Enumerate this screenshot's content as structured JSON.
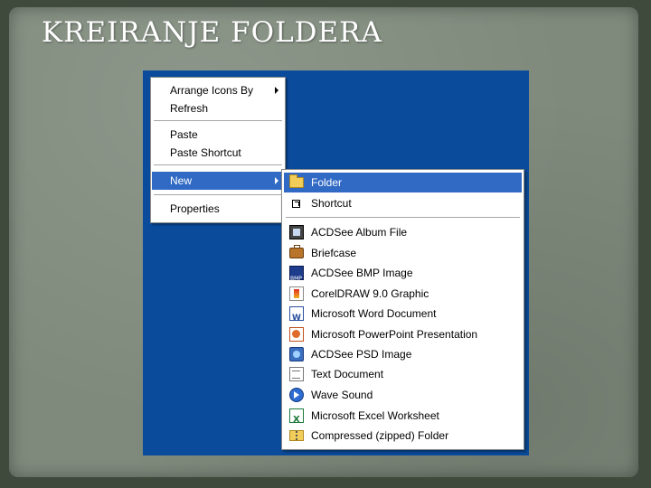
{
  "slide": {
    "title": "KREIRANJE FOLDERA"
  },
  "context_menu": {
    "items": [
      {
        "label": "Arrange Icons By",
        "submenu": true
      },
      {
        "label": "Refresh"
      },
      {
        "label": "Paste"
      },
      {
        "label": "Paste Shortcut"
      },
      {
        "label": "New",
        "submenu": true,
        "selected": true
      },
      {
        "label": "Properties"
      }
    ]
  },
  "new_submenu": {
    "items": [
      {
        "label": "Folder",
        "icon": "folder-icon",
        "selected": true
      },
      {
        "label": "Shortcut",
        "icon": "shortcut-icon"
      },
      {
        "label": "ACDSee Album File",
        "icon": "album-file-icon"
      },
      {
        "label": "Briefcase",
        "icon": "briefcase-icon"
      },
      {
        "label": "ACDSee BMP Image",
        "icon": "bmp-image-icon"
      },
      {
        "label": "CorelDRAW 9.0 Graphic",
        "icon": "coreldraw-icon"
      },
      {
        "label": "Microsoft Word Document",
        "icon": "word-document-icon"
      },
      {
        "label": "Microsoft PowerPoint Presentation",
        "icon": "powerpoint-icon"
      },
      {
        "label": "ACDSee PSD Image",
        "icon": "psd-image-icon"
      },
      {
        "label": "Text Document",
        "icon": "text-document-icon"
      },
      {
        "label": "Wave Sound",
        "icon": "wave-sound-icon"
      },
      {
        "label": "Microsoft Excel Worksheet",
        "icon": "excel-worksheet-icon"
      },
      {
        "label": "Compressed (zipped) Folder",
        "icon": "zip-folder-icon"
      }
    ]
  },
  "colors": {
    "desktop": "#0a4b9b",
    "selection": "#316ac5",
    "slide_background": "#7f8a7c"
  }
}
